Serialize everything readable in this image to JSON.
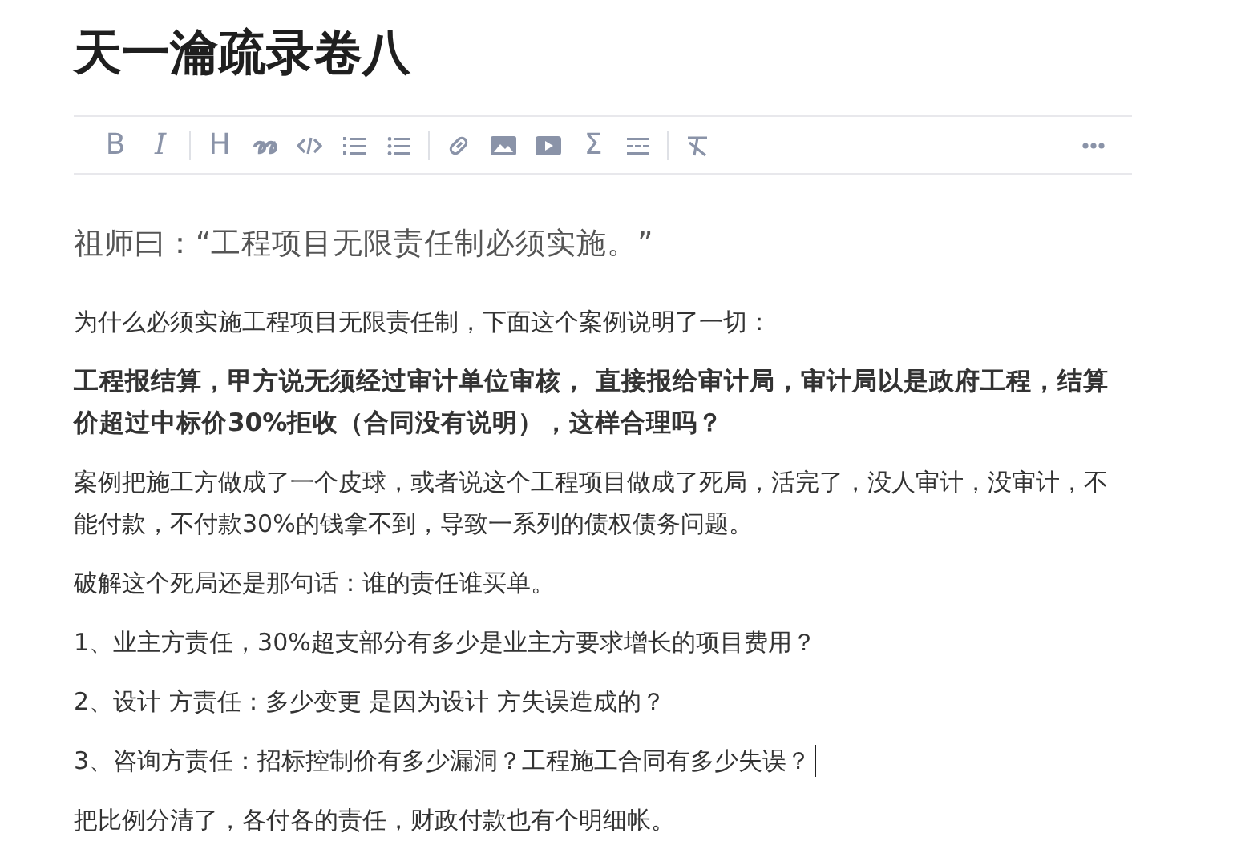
{
  "title": "天一瀹疏录卷八",
  "toolbar": {
    "groups": [
      [
        {
          "kind": "glyph",
          "text": "B"
        },
        {
          "kind": "italic-glyph",
          "text": "I"
        }
      ],
      [
        {
          "kind": "glyph",
          "text": "H"
        },
        {
          "kind": "quote"
        },
        {
          "kind": "code"
        },
        {
          "kind": "ordered-list"
        },
        {
          "kind": "bullet-list"
        }
      ],
      [
        {
          "kind": "link"
        },
        {
          "kind": "image"
        },
        {
          "kind": "video"
        },
        {
          "kind": "glyph",
          "text": "Σ"
        },
        {
          "kind": "divider"
        }
      ],
      [
        {
          "kind": "clear-format"
        }
      ]
    ],
    "more": {
      "kind": "more"
    }
  },
  "paragraphs": [
    {
      "kind": "lead",
      "text": "祖师曰：“工程项目无限责任制必须实施。”"
    },
    {
      "kind": "plain",
      "text": "为什么必须实施工程项目无限责任制，下面这个案例说明了一切："
    },
    {
      "kind": "bold",
      "text": "工程报结算，甲方说无须经过审计单位审核， 直接报给审计局，审计局以是政府工程，结算价超过中标价30%拒收（合同没有说明），这样合理吗？"
    },
    {
      "kind": "plain",
      "text": "案例把施工方做成了一个皮球，或者说这个工程项目做成了死局，活完了，没人审计，没审计，不能付款，不付款30%的钱拿不到，导致一系列的债权债务问题。"
    },
    {
      "kind": "plain",
      "text": "破解这个死局还是那句话：谁的责任谁买单。"
    },
    {
      "kind": "plain",
      "text": "1、业主方责任，30%超支部分有多少是业主方要求增长的项目费用？"
    },
    {
      "kind": "plain",
      "text": "2、设计 方责任：多少变更 是因为设计 方失误造成的？"
    },
    {
      "kind": "plain",
      "text": "3、咨询方责任：招标控制价有多少漏洞？工程施工合同有多少失误？",
      "cursor": true
    },
    {
      "kind": "plain",
      "text": "把比例分清了，各付各的责任，财政付款也有个明细帐。"
    }
  ]
}
